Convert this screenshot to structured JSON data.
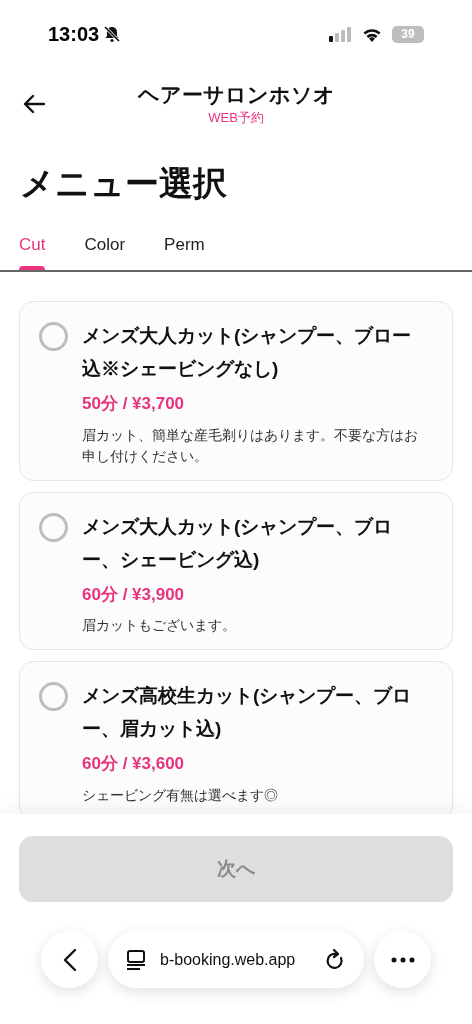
{
  "status_bar": {
    "time": "13:03",
    "battery": "39"
  },
  "header": {
    "title": "ヘアーサロンホソオ",
    "subtitle": "WEB予約"
  },
  "page_title": "メニュー選択",
  "tabs": [
    {
      "label": "Cut",
      "selected": true
    },
    {
      "label": "Color",
      "selected": false
    },
    {
      "label": "Perm",
      "selected": false
    }
  ],
  "menu_items": [
    {
      "name": "メンズ大人カット(シャンプー、ブロー込※シェービングなし)",
      "price": "50分 / ¥3,700",
      "description": "眉カット、簡単な産毛剃りはあります。不要な方はお申し付けください。",
      "selected": false
    },
    {
      "name": "メンズ大人カット(シャンプー、ブロー、シェービング込)",
      "price": "60分 / ¥3,900",
      "description": "眉カットもございます。",
      "selected": false
    },
    {
      "name": "メンズ高校生カット(シャンプー、ブロー、眉カット込)",
      "price": "60分 / ¥3,600",
      "description": "シェービング有無は選べます◎",
      "selected": false
    }
  ],
  "next_button": {
    "label": "次へ",
    "disabled": true
  },
  "browser_bar": {
    "url": "b-booking.web.app"
  }
}
